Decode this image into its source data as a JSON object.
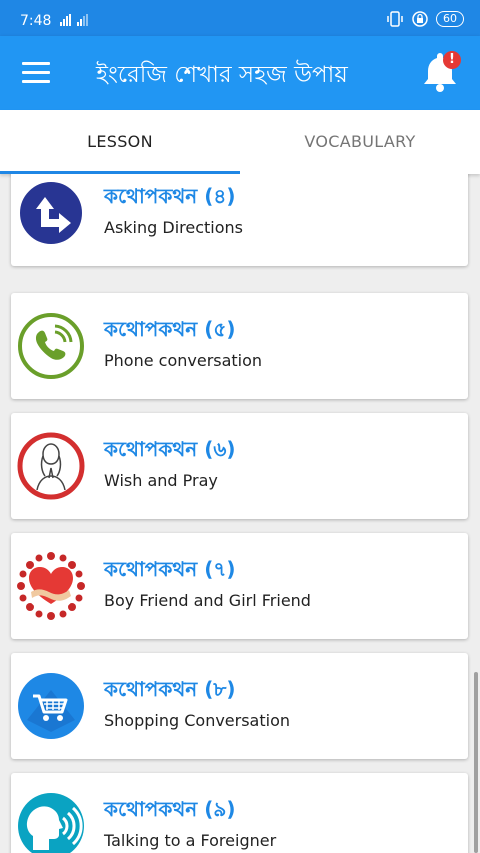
{
  "status": {
    "time": "7:48",
    "battery": "60"
  },
  "appbar": {
    "title": "ইংরেজি শেখার সহজ উপায়",
    "notification_badge": "!"
  },
  "tabs": [
    {
      "label": "LESSON"
    },
    {
      "label": "VOCABULARY"
    }
  ],
  "lessons": [
    {
      "bn": "কথোপকথন (৪)",
      "en": "Asking Directions",
      "icon": "directions-icon"
    },
    {
      "bn": "কথোপকথন (৫)",
      "en": "Phone conversation",
      "icon": "phone-icon"
    },
    {
      "bn": "কথোপকথন (৬)",
      "en": "Wish and Pray",
      "icon": "praying-woman-icon"
    },
    {
      "bn": "কথোপকথন (৭)",
      "en": "Boy Friend and Girl Friend",
      "icon": "heart-icon"
    },
    {
      "bn": "কথোপকথন (৮)",
      "en": "Shopping Conversation",
      "icon": "shopping-cart-icon"
    },
    {
      "bn": "কথোপকথন (৯)",
      "en": "Talking to a Foreigner",
      "icon": "speaking-head-icon"
    }
  ],
  "colors": {
    "statusbar": "#1f87e5",
    "appbar": "#2196f3",
    "accent": "#1e88e5"
  }
}
